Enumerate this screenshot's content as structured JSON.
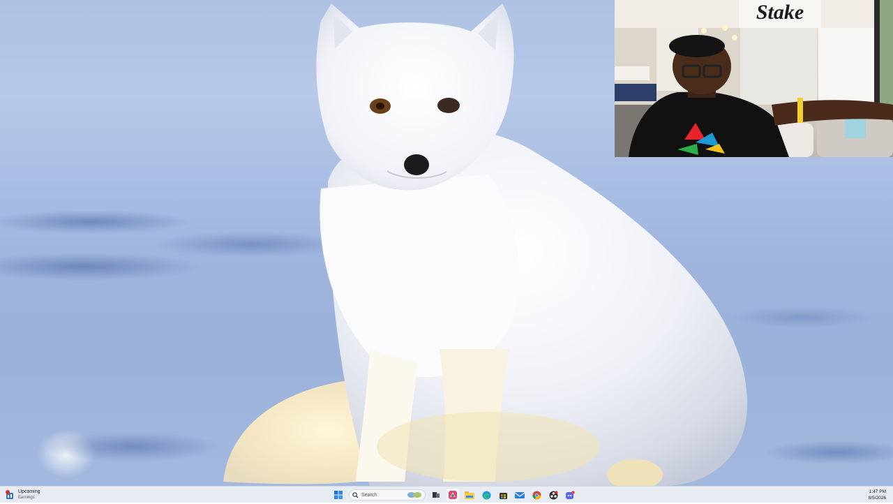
{
  "webcam": {
    "brand_sign": "Stake"
  },
  "taskbar": {
    "widget": {
      "title": "Upcoming",
      "subtitle": "Earnings",
      "badge": "1"
    },
    "search": {
      "placeholder": "Search"
    },
    "pinned_icons": [
      "start-icon",
      "search",
      "task-view-icon",
      "copilot-icon",
      "file-explorer-icon",
      "edge-icon",
      "microsoft-store-icon",
      "mail-icon",
      "chrome-icon",
      "obs-icon",
      "discord-icon"
    ],
    "clock": {
      "time": "1:47 PM",
      "date": "8/5/2026"
    }
  }
}
